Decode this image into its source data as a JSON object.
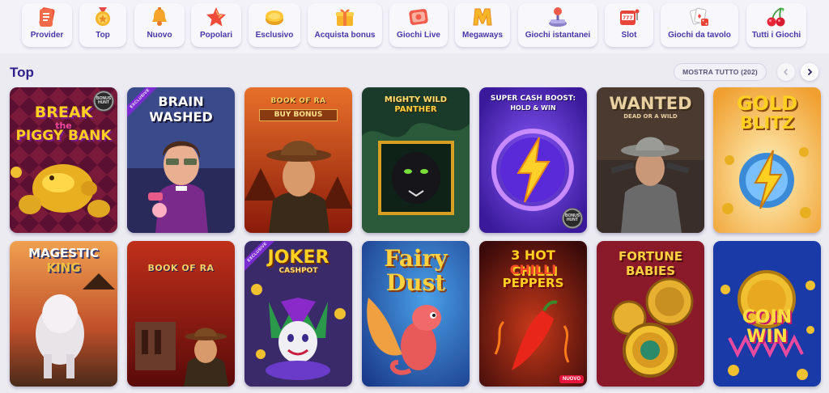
{
  "categories": [
    {
      "label": "Provider",
      "icon": "provider-icon"
    },
    {
      "label": "Top",
      "icon": "medal-icon"
    },
    {
      "label": "Nuovo",
      "icon": "bell-icon"
    },
    {
      "label": "Popolari",
      "icon": "star-icon"
    },
    {
      "label": "Esclusivo",
      "icon": "coin-icon"
    },
    {
      "label": "Acquista bonus",
      "icon": "gift-icon"
    },
    {
      "label": "Giochi Live",
      "icon": "live-icon"
    },
    {
      "label": "Megaways",
      "icon": "megaways-icon"
    },
    {
      "label": "Giochi istantanei",
      "icon": "joystick-icon"
    },
    {
      "label": "Slot",
      "icon": "slot-machine-icon"
    },
    {
      "label": "Giochi da tavolo",
      "icon": "cards-dice-icon"
    },
    {
      "label": "Tutti i Giochi",
      "icon": "cherries-icon"
    }
  ],
  "section": {
    "title": "Top",
    "show_all": "MOSTRA TUTTO (202)"
  },
  "badges": {
    "exclusive": "EXCLUSIVE",
    "hunt": "BONUS HUNT",
    "new": "NUOVO"
  },
  "games": [
    {
      "title": "BREAK the PIGGY BANK",
      "line1": "BREAK",
      "line2": "the",
      "line3": "PIGGY BANK"
    },
    {
      "title": "BRAIN WASHED",
      "line1": "BRAIN",
      "line2": "WASHED"
    },
    {
      "title": "BOOK OF RA BUY BONUS",
      "line1": "BOOK OF RA",
      "line2": "BUY BONUS"
    },
    {
      "title": "MIGHTY WILD PANTHER",
      "line1": "MIGHTY WILD",
      "line2": "PANTHER"
    },
    {
      "title": "SUPER CASH BOOST: HOLD & WIN",
      "line1": "SUPER CASH BOOST:",
      "line2": "HOLD & WIN"
    },
    {
      "title": "WANTED DEAD OR A WILD",
      "line1": "WANTED",
      "line2": "DEAD OR A WILD"
    },
    {
      "title": "GOLD BLITZ",
      "line1": "GOLD",
      "line2": "BLITZ"
    },
    {
      "title": "MAGESTIC KING",
      "line1": "MAGESTIC",
      "line2": "KING"
    },
    {
      "title": "BOOK OF RA",
      "line1": "BOOK OF RA"
    },
    {
      "title": "JOKER CASHPOT",
      "line1": "JOKER",
      "line2": "CASHPOT"
    },
    {
      "title": "Fairy Dust",
      "line1": "Fairy",
      "line2": "Dust"
    },
    {
      "title": "3 HOT CHILLI PEPPERS",
      "line1": "3 HOT",
      "line2": "CHILLI",
      "line3": "PEPPERS"
    },
    {
      "title": "FORTUNE BABIES",
      "line1": "FORTUNE",
      "line2": "BABIES"
    },
    {
      "title": "COIN WIN",
      "line1": "COIN",
      "line2": "WIN"
    }
  ]
}
